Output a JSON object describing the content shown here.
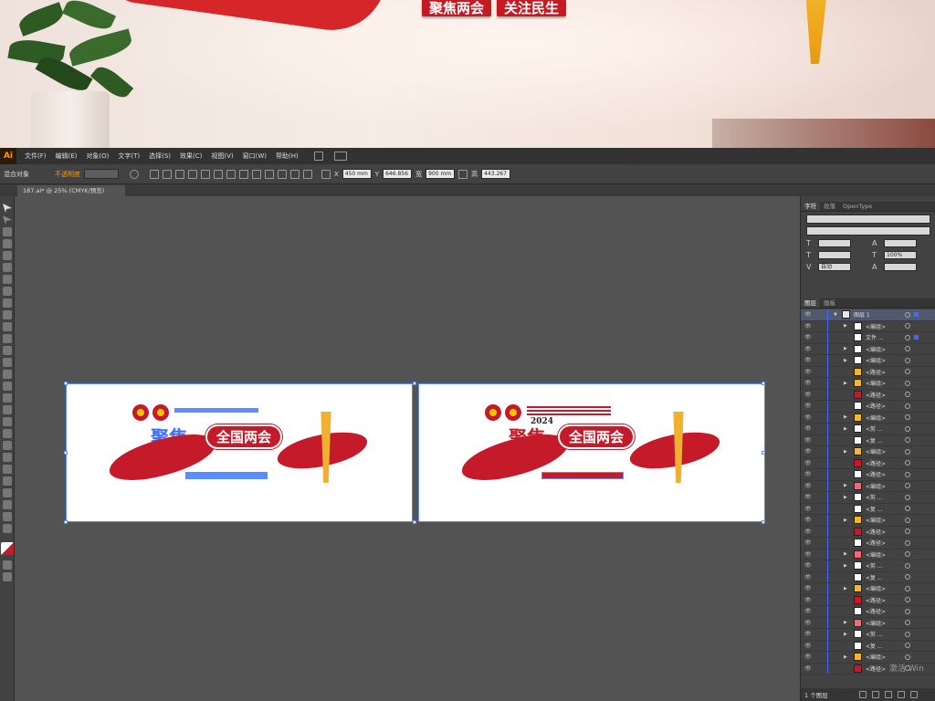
{
  "photo": {
    "banner_words": [
      "聚焦两会",
      "关注民生"
    ]
  },
  "menubar": {
    "logo": "Ai",
    "items": [
      "文件(F)",
      "编辑(E)",
      "对象(O)",
      "文字(T)",
      "选择(S)",
      "效果(C)",
      "视图(V)",
      "窗口(W)",
      "帮助(H)"
    ]
  },
  "control_bar": {
    "selection_label": "混合对象",
    "opacity_label": "不透明度",
    "x_value": "450 mm",
    "y_value": "646.856",
    "w_value": "900 mm",
    "h_value": "443.267"
  },
  "document": {
    "tab_title": "187.ai* @ 25% (CMYK/预览)"
  },
  "artboards": {
    "title_text": "全国两会",
    "left_big_char": "聚焦",
    "right_big_char": "聚焦",
    "year": "2024"
  },
  "char_panel": {
    "tabs": [
      "字符",
      "段落",
      "OpenType"
    ],
    "leading_value": "自动",
    "scale_value": "100%"
  },
  "layers_panel": {
    "tabs": [
      "图层",
      "画板"
    ],
    "rows": [
      {
        "name": "图层 1",
        "thumb": "#e8e8e8",
        "arrow": "▼"
      },
      {
        "name": "<编组>",
        "thumb": "#ffffff",
        "arrow": "▶"
      },
      {
        "name": "文件 ...",
        "thumb": "#ffffff",
        "arrow": ""
      },
      {
        "name": "<编组>",
        "thumb": "#ffffff",
        "arrow": "▶"
      },
      {
        "name": "<编组>",
        "thumb": "#ffffff",
        "arrow": "▶"
      },
      {
        "name": "<路径>",
        "thumb": "#f2b632",
        "arrow": ""
      },
      {
        "name": "<编组>",
        "thumb": "#f2b632",
        "arrow": "▶"
      },
      {
        "name": "<路径>",
        "thumb": "#c41a2a",
        "arrow": ""
      },
      {
        "name": "<路径>",
        "thumb": "#ffffff",
        "arrow": ""
      },
      {
        "name": "<编组>",
        "thumb": "#f2b632",
        "arrow": "▶"
      },
      {
        "name": "<剪 ...",
        "thumb": "#ffffff",
        "arrow": "▶"
      },
      {
        "name": "<复 ...",
        "thumb": "#ffffff",
        "arrow": ""
      },
      {
        "name": "<编组>",
        "thumb": "#f2b632",
        "arrow": "▶"
      },
      {
        "name": "<路径>",
        "thumb": "#c41a2a",
        "arrow": ""
      },
      {
        "name": "<路径>",
        "thumb": "#ffffff",
        "arrow": ""
      },
      {
        "name": "<编组>",
        "thumb": "#f26a72",
        "arrow": "▶"
      },
      {
        "name": "<剪 ...",
        "thumb": "#ffffff",
        "arrow": "▶"
      },
      {
        "name": "<复 ...",
        "thumb": "#ffffff",
        "arrow": ""
      },
      {
        "name": "<编组>",
        "thumb": "#f2b632",
        "arrow": "▶"
      },
      {
        "name": "<路径>",
        "thumb": "#c41a2a",
        "arrow": ""
      },
      {
        "name": "<路径>",
        "thumb": "#ffffff",
        "arrow": ""
      },
      {
        "name": "<编组>",
        "thumb": "#f26a72",
        "arrow": "▶"
      },
      {
        "name": "<剪 ...",
        "thumb": "#ffffff",
        "arrow": "▶"
      },
      {
        "name": "<复 ...",
        "thumb": "#ffffff",
        "arrow": ""
      },
      {
        "name": "<编组>",
        "thumb": "#f2b632",
        "arrow": "▶"
      },
      {
        "name": "<路径>",
        "thumb": "#c41a2a",
        "arrow": ""
      },
      {
        "name": "<路径>",
        "thumb": "#ffffff",
        "arrow": ""
      },
      {
        "name": "<编组>",
        "thumb": "#f26a72",
        "arrow": "▶"
      },
      {
        "name": "<剪 ...",
        "thumb": "#ffffff",
        "arrow": "▶"
      },
      {
        "name": "<复 ...",
        "thumb": "#ffffff",
        "arrow": ""
      },
      {
        "name": "<编组>",
        "thumb": "#f2b632",
        "arrow": "▶"
      },
      {
        "name": "<路径>",
        "thumb": "#c41a2a",
        "arrow": ""
      }
    ],
    "footer_count": "1 个图层"
  },
  "os_overlay": {
    "activate_text": "激活 Win"
  }
}
